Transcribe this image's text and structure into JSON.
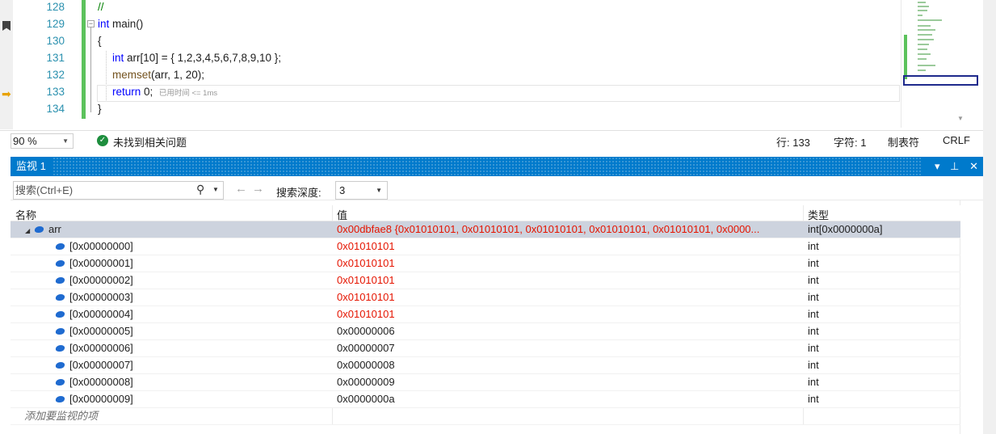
{
  "editor": {
    "lines": [
      {
        "no": "128",
        "text": "//"
      },
      {
        "no": "129",
        "kw": "int",
        "text": " main()"
      },
      {
        "no": "130",
        "text": "{"
      },
      {
        "no": "131",
        "kw": "int",
        "text": " arr[10] = { 1,2,3,4,5,6,7,8,9,10 };"
      },
      {
        "no": "132",
        "fn": "memset",
        "text": "(arr, 1, 20);"
      },
      {
        "no": "133",
        "kw": "return",
        "text": " 0;",
        "elapsed": "已用时间 <= 1ms"
      },
      {
        "no": "134",
        "text": "}"
      }
    ],
    "collapse_symbol": "−"
  },
  "status": {
    "zoom": "90 %",
    "issues": "未找到相关问题",
    "line": "行: 133",
    "char": "字符: 1",
    "tabs": "制表符",
    "eol": "CRLF"
  },
  "watch": {
    "title": "监视 1",
    "search_placeholder": "搜索(Ctrl+E)",
    "depth_label": "搜索深度:",
    "depth_value": "3",
    "columns": {
      "name": "名称",
      "value": "值",
      "type": "类型"
    },
    "root": {
      "name": "arr",
      "value": "0x00dbfae8 {0x01010101, 0x01010101, 0x01010101, 0x01010101, 0x01010101, 0x0000...",
      "type": "int[0x0000000a]"
    },
    "items": [
      {
        "name": "[0x00000000]",
        "value": "0x01010101",
        "type": "int",
        "changed": true
      },
      {
        "name": "[0x00000001]",
        "value": "0x01010101",
        "type": "int",
        "changed": true
      },
      {
        "name": "[0x00000002]",
        "value": "0x01010101",
        "type": "int",
        "changed": true
      },
      {
        "name": "[0x00000003]",
        "value": "0x01010101",
        "type": "int",
        "changed": true
      },
      {
        "name": "[0x00000004]",
        "value": "0x01010101",
        "type": "int",
        "changed": true
      },
      {
        "name": "[0x00000005]",
        "value": "0x00000006",
        "type": "int",
        "changed": false
      },
      {
        "name": "[0x00000006]",
        "value": "0x00000007",
        "type": "int",
        "changed": false
      },
      {
        "name": "[0x00000007]",
        "value": "0x00000008",
        "type": "int",
        "changed": false
      },
      {
        "name": "[0x00000008]",
        "value": "0x00000009",
        "type": "int",
        "changed": false
      },
      {
        "name": "[0x00000009]",
        "value": "0x0000000a",
        "type": "int",
        "changed": false
      }
    ],
    "add_item": "添加要监视的项"
  },
  "colors": {
    "accent": "#007acc",
    "changed_value": "#e51400",
    "line_number": "#2b91af",
    "keyword": "#0000ff",
    "comment": "#008000",
    "change_bar": "#5cc25c"
  },
  "icons": {
    "bookmark": "bookmark-icon",
    "current_statement": "current-statement-arrow-icon",
    "no_issues": "check-circle-icon",
    "search": "search-icon",
    "variable": "variable-icon",
    "pin": "pin-icon",
    "close": "close-icon",
    "dropdown": "chevron-down-icon"
  }
}
